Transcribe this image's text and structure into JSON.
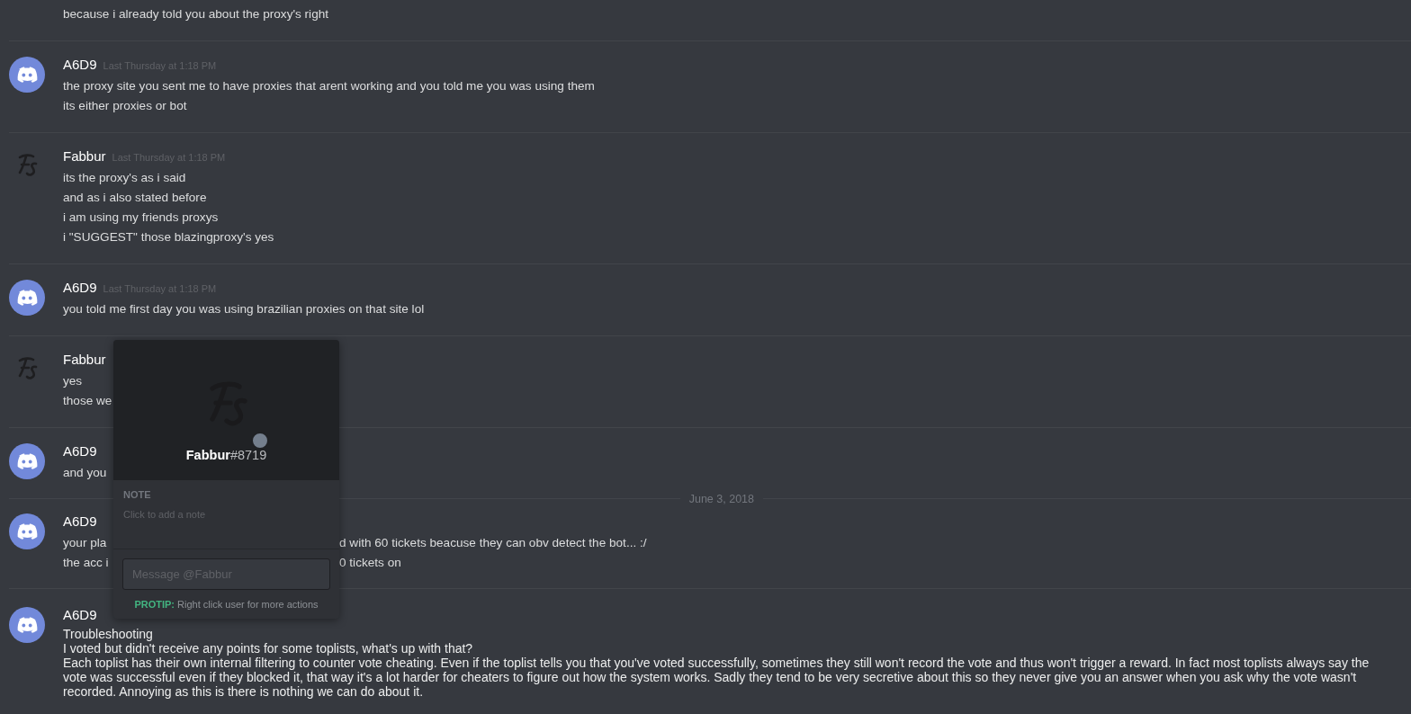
{
  "messages": [
    {
      "kind": "continuation",
      "lines": [
        {
          "text": "because i already told you about the proxy's right"
        }
      ]
    },
    {
      "kind": "message",
      "author": "A6D9",
      "avatar": {
        "kind": "discord"
      },
      "timestamp": "Last Thursday at 1:18 PM",
      "lines": [
        {
          "text": "the proxy site you sent me to have proxies that arent working and you told me you was using them"
        },
        {
          "text": "its either proxies or bot"
        }
      ]
    },
    {
      "kind": "message",
      "author": "Fabbur",
      "avatar": {
        "kind": "logo"
      },
      "timestamp": "Last Thursday at 1:18 PM",
      "lines": [
        {
          "text": "its the proxy's as i said"
        },
        {
          "text": "and as i also stated before"
        },
        {
          "text": "i am using my friends proxys"
        },
        {
          "text": "i \"SUGGEST\" those blazingproxy's yes"
        }
      ]
    },
    {
      "kind": "message",
      "author": "A6D9",
      "avatar": {
        "kind": "discord"
      },
      "timestamp": "Last Thursday at 1:18 PM",
      "lines": [
        {
          "text": "you told me first day you was using brazilian proxies on that site lol"
        }
      ]
    },
    {
      "kind": "message",
      "author": "Fabbur",
      "avatar": {
        "kind": "logo"
      },
      "lines": [
        {
          "text": "yes"
        },
        {
          "text": "those we"
        }
      ]
    },
    {
      "kind": "message",
      "author": "A6D9",
      "avatar": {
        "kind": "discord"
      },
      "lines": [
        {
          "text": "and you"
        }
      ]
    },
    {
      "kind": "date_divider",
      "label": "June 3, 2018"
    },
    {
      "kind": "message",
      "author": "A6D9",
      "avatar": {
        "kind": "discord"
      },
      "lines": [
        {
          "text": "your pla",
          "right": "d with 60 tickets beacuse they can obv detect the bot... :/"
        },
        {
          "text": "the acc i",
          "right": "0 tickets on"
        }
      ]
    },
    {
      "kind": "pasted_message",
      "author": "A6D9",
      "avatar": {
        "kind": "discord"
      },
      "lines": [
        {
          "text": "Troubleshooting"
        },
        {
          "text": "I voted but didn't receive any points for some toplists, what's up with that?"
        },
        {
          "text": "Each toplist has their own internal filtering to counter vote cheating. Even if the toplist tells you that you've voted successfully, sometimes they still won't record the vote and thus won't trigger a reward. In fact most toplists always say the vote was successful even if they blocked it, that way it's a lot harder for cheaters to figure out how the system works. Sadly they tend to be very secretive about this so they never give you an answer when you ask why the vote wasn't recorded. Annoying as this is there is nothing we can do about it."
        }
      ]
    }
  ],
  "profile_popup": {
    "avatar": {
      "kind": "logo"
    },
    "username": "Fabbur",
    "discriminator": "#8719",
    "online": false,
    "note_label": "NOTE",
    "note_placeholder": "Click to add a note",
    "message_placeholder": "Message @Fabbur",
    "protip_label": "PROTIP:",
    "protip_text": "Right click user for more actions"
  }
}
